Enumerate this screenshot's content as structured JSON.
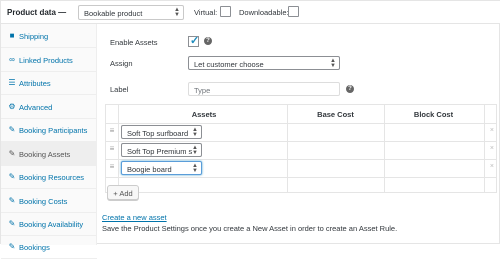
{
  "header": {
    "title": "Product data —",
    "product_type": "Bookable product",
    "virtual_label": "Virtual:",
    "downloadable_label": "Downloadable:"
  },
  "tabs": [
    {
      "label": "Shipping",
      "icon": "truck-icon"
    },
    {
      "label": "Linked Products",
      "icon": "link-icon"
    },
    {
      "label": "Attributes",
      "icon": "list-icon"
    },
    {
      "label": "Advanced",
      "icon": "gear-icon"
    },
    {
      "label": "Booking Participants",
      "icon": "wrench-icon"
    },
    {
      "label": "Booking Assets",
      "icon": "wrench-icon",
      "active": true
    },
    {
      "label": "Booking Resources",
      "icon": "wrench-icon"
    },
    {
      "label": "Booking Costs",
      "icon": "wrench-icon"
    },
    {
      "label": "Booking Availability",
      "icon": "wrench-icon"
    },
    {
      "label": "Bookings",
      "icon": "wrench-icon"
    }
  ],
  "form": {
    "enable_assets_label": "Enable Assets",
    "enable_assets_checked": true,
    "assign_label": "Assign",
    "assign_value": "Let customer choose",
    "label_label": "Label",
    "label_placeholder": "Type"
  },
  "assets_table": {
    "columns": [
      "Assets",
      "Base Cost",
      "Block Cost"
    ],
    "rows": [
      {
        "asset": "Soft Top surfboard",
        "base_cost": "",
        "block_cost": ""
      },
      {
        "asset": "Soft Top Premium s",
        "base_cost": "",
        "block_cost": ""
      },
      {
        "asset": "Boogie board",
        "base_cost": "",
        "block_cost": ""
      }
    ],
    "remove_symbol": "×",
    "handle_symbol": "≡"
  },
  "add_button": "+ Add",
  "create_link": "Create a new asset",
  "note": "Save the Product Settings once you create a New Asset in order to create an Asset Rule.",
  "colors": {
    "link": "#0073aa",
    "active_tab_bg": "#eeeeee",
    "check": "#1e8cbe"
  }
}
